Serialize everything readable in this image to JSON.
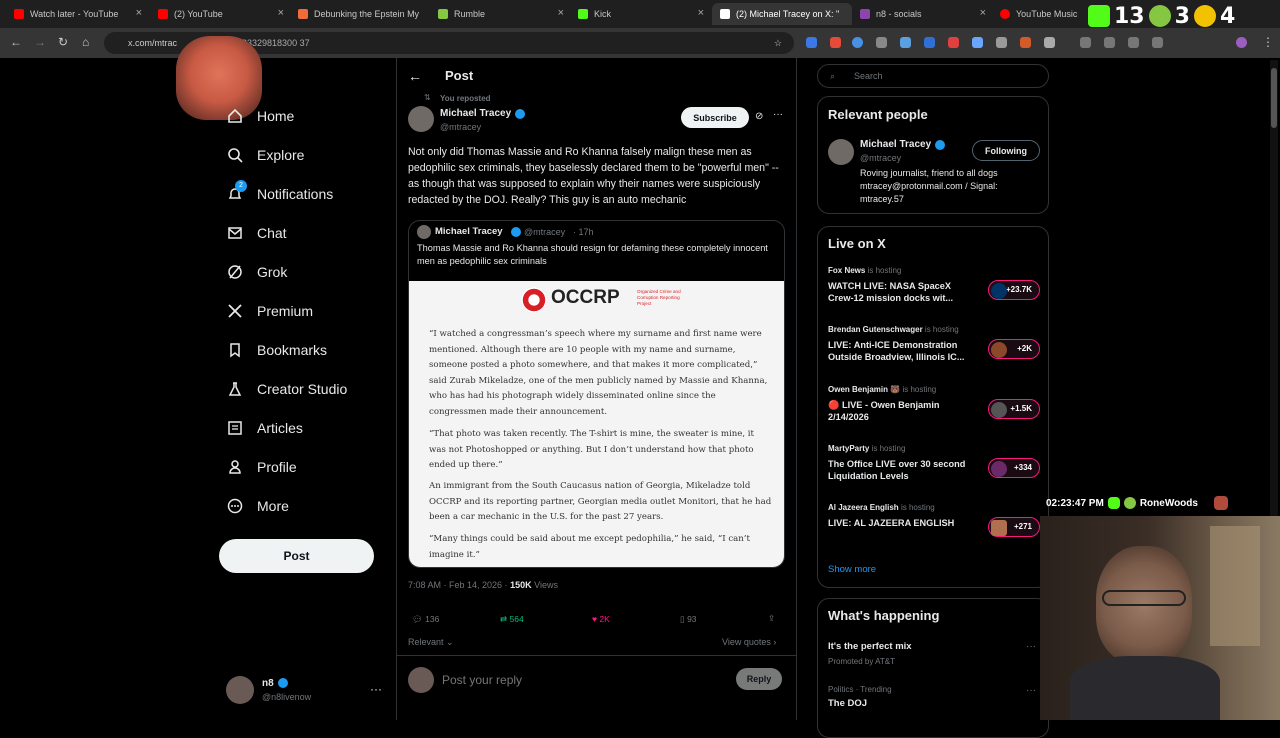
{
  "browser": {
    "tabs": [
      {
        "title": "Watch later - YouTube",
        "color": "#ff0000"
      },
      {
        "title": "(2) YouTube",
        "color": "#ff0000"
      },
      {
        "title": "Debunking the Epstein My",
        "color": "#f26b3a"
      },
      {
        "title": "Rumble",
        "color": "#85c742"
      },
      {
        "title": "Kick",
        "color": "#53fc18"
      },
      {
        "title": "(2) Michael Tracey on X: \"",
        "color": "#ffffff"
      },
      {
        "title": "n8 - socials",
        "color": "#8e44ad"
      },
      {
        "title": "YouTube Music",
        "color": "#ff0000"
      }
    ],
    "url_visible_start": "x.com/mtrac",
    "url_visible_end": "6893329818300 37"
  },
  "stream_overlay_top": {
    "kick_count": "13",
    "rumble_count": "3",
    "other_count": "4"
  },
  "nav": {
    "items": [
      {
        "label": "Home",
        "icon": "home-icon"
      },
      {
        "label": "Explore",
        "icon": "search-icon"
      },
      {
        "label": "Notifications",
        "icon": "bell-icon",
        "badge": "2"
      },
      {
        "label": "Chat",
        "icon": "mail-icon"
      },
      {
        "label": "Grok",
        "icon": "grok-icon"
      },
      {
        "label": "Premium",
        "icon": "x-logo-icon"
      },
      {
        "label": "Bookmarks",
        "icon": "bookmark-icon"
      },
      {
        "label": "Creator Studio",
        "icon": "flask-icon"
      },
      {
        "label": "Articles",
        "icon": "article-icon"
      },
      {
        "label": "Profile",
        "icon": "person-icon"
      },
      {
        "label": "More",
        "icon": "more-circle-icon"
      }
    ],
    "post_button": "Post",
    "account_name": "n8",
    "account_handle": "@n8livenow"
  },
  "post": {
    "header_title": "Post",
    "reposted_label": "You reposted",
    "author_name": "Michael Tracey",
    "author_handle": "@mtracey",
    "subscribe_label": "Subscribe",
    "text": "Not only did Thomas Massie and Ro Khanna falsely malign these men as pedophilic sex criminals, they baselessly declared them to be \"powerful men\" -- as though that was supposed to explain why their names were suspiciously redacted by the DOJ. Really? This guy is an auto mechanic",
    "quote": {
      "author_name": "Michael Tracey",
      "author_handle": "@mtracey",
      "time": "· 17h",
      "text": "Thomas Massie and Ro Khanna should resign for defaming these completely innocent men as pedophilic sex criminals",
      "article_logo": "OCCRP",
      "article_logo_sub": "Organized Crime and Corruption Reporting Project",
      "paragraphs": [
        "“I watched a congressman’s speech where my surname and first name were mentioned. Although there are 10 people with my name and surname, someone posted a photo somewhere, and that makes it more complicated,” said Zurab Mikeladze, one of the men publicly named by Massie and Khanna, who has had his photograph widely disseminated online since the congressmen made their announcement.",
        "“That photo was taken recently. The T-shirt is mine, the sweater is mine, it was not Photoshopped or anything. But I don’t understand how that photo ended up there.”",
        "An immigrant from the South Caucasus nation of Georgia, Mikeladze told OCCRP and its reporting partner, Georgian media outlet Monitori, that he had been a car mechanic in the U.S. for the past 27 years.",
        "“Many things could be said about me except pedophilia,” he said, “I can’t imagine it.”"
      ]
    },
    "timestamp": "7:08 AM · Feb 14, 2026 ·",
    "views_count": "150K",
    "views_label": "Views",
    "replies": "136",
    "reposts": "564",
    "likes": "2K",
    "bookmarks": "93",
    "sort_label": "Relevant",
    "view_quotes": "View quotes",
    "reply_placeholder": "Post your reply",
    "reply_button": "Reply"
  },
  "right": {
    "search_placeholder": "Search",
    "relevant_title": "Relevant people",
    "person": {
      "name": "Michael Tracey",
      "handle": "@mtracey",
      "follow_label": "Following",
      "bio": "Roving journalist, friend to all dogs mtracey@protonmail.com / Signal: mtracey.57"
    },
    "live_title": "Live on X",
    "live": [
      {
        "host": "Fox News",
        "hosting": "is hosting",
        "title": "WATCH LIVE: NASA SpaceX Crew-12 mission docks wit...",
        "count": "+23.7K",
        "color": "#003366"
      },
      {
        "host": "Brendan Gutenschwager",
        "hosting": "is hosting",
        "title": "LIVE: Anti-ICE Demonstration Outside Broadview, Illinois IC...",
        "count": "+2K",
        "color": "#8a4a2a"
      },
      {
        "host": "Owen Benjamin 🐻",
        "hosting": "is hosting",
        "title": "🔴 LIVE - Owen Benjamin 2/14/2026",
        "count": "+1.5K",
        "color": "#555555"
      },
      {
        "host": "MartyParty",
        "hosting": "is hosting",
        "title": "The Office LIVE over 30 second Liquidation Levels",
        "count": "+334",
        "color": "#6a2a6a"
      },
      {
        "host": "Al Jazeera English",
        "hosting": "is hosting",
        "title": "LIVE: AL JAZEERA ENGLISH",
        "count": "+271",
        "color": "#b07050"
      }
    ],
    "show_more": "Show more",
    "happening_title": "What's happening",
    "trends": [
      {
        "title": "It's the perfect mix",
        "meta": "Promoted by AT&T"
      },
      {
        "meta": "Politics · Trending",
        "title": "The DOJ"
      }
    ]
  },
  "stream_overlay": {
    "clock": "02:23:47 PM",
    "channel": "RoneWoods"
  }
}
